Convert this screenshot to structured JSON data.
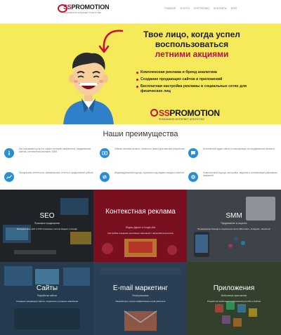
{
  "header": {
    "logo_ss": "SS",
    "logo_word": "PROMOTION",
    "logo_tag": "РЕКЛАМНОЕ ИНТЕРНЕТ АГЕНТСТВО",
    "nav": [
      "Главная",
      "Услуги",
      "Портфолио",
      "Контакты",
      "Блог"
    ]
  },
  "hero": {
    "title_line1": "Твое лицо, когда успел",
    "title_line2": "воспользоваться",
    "title_line3": "летними акциями",
    "bullets": [
      "Комплексная реклама и бренд аналитика",
      "Создание продающих сайтов и приложений",
      "Бесплатная настройка рекламы в социальных сетях для физических лиц"
    ],
    "brand_ss": "SS",
    "brand_word": "PROMOTION",
    "brand_tag": "РЕКЛАМНОЕ ИНТЕРНЕТ АГЕНТСТВО"
  },
  "advantages": {
    "title": "Наши преимущества",
    "items": [
      {
        "icon": "info-icon",
        "text": "Мы оказываем услуги в сфере интернет-маркетинга: продвижение сайтов, контекстная реклама, SMM"
      },
      {
        "icon": "money-icon",
        "text": "Гибкая система оплаты: оплата по факту достижения результата"
      },
      {
        "icon": "chat-icon",
        "text": "Бесплатный аудит сайта и консультация по продвижению бизнеса"
      },
      {
        "icon": "chart-icon",
        "text": "Прозрачная отчетность: ежемесячные отчеты о проделанной работе"
      },
      {
        "icon": "target-icon",
        "text": "Индивидуальный подход: стратегия под задачи каждого клиента"
      },
      {
        "icon": "gear-icon",
        "text": "Комплексный подход: настройка, ведение и оптимизация рекламных кампаний"
      }
    ]
  },
  "services": [
    {
      "title": "SEO",
      "sub": "Поисковое продвижение",
      "desc": "Выведем ваш сайт в ТОП поисковых систем Яндекс и Google"
    },
    {
      "title": "Контекстная реклама",
      "sub": "Яндекс.Директ и Google Ads",
      "desc": "Настройка и ведение рекламных кампаний с гарантией результата"
    },
    {
      "title": "SMM",
      "sub": "Продвижение в соцсетях",
      "desc": "Продвижение бренда в социальных сетях ВКонтакте, Instagram, Facebook"
    },
    {
      "title": "Сайты",
      "sub": "Разработка сайтов",
      "desc": "Создание продающих сайтов, лендингов и интернет-магазинов"
    },
    {
      "title": "E-mail маркетинг",
      "sub": "Email рассылки",
      "desc": "Разработка и запуск эффективных email рассылок"
    },
    {
      "title": "Приложения",
      "sub": "Мобильные приложения",
      "desc": "Разработка мобильных приложений для iOS и Android"
    }
  ],
  "colors": {
    "brand_red": "#c8102e",
    "hero_yellow": "#f6ea5a",
    "accent_blue": "#2a8fd0"
  }
}
